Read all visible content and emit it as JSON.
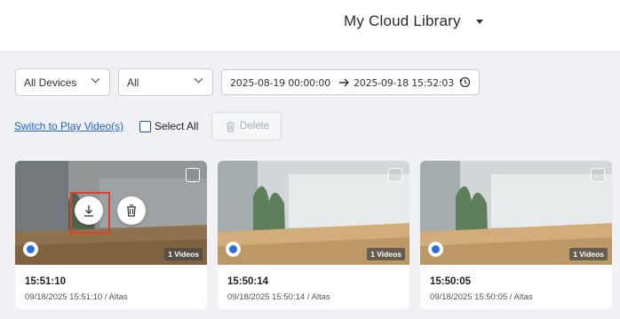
{
  "header": {
    "title": "My Cloud Library"
  },
  "filters": {
    "device": "All Devices",
    "type": "All",
    "start": "2025-08-19  00:00:00",
    "end": "2025-09-18  15:52:03"
  },
  "toolbar": {
    "switch_label": "Switch to Play Video(s)",
    "select_all_label": "Select All",
    "delete_label": "Delete"
  },
  "cards": [
    {
      "time": "15:51:10",
      "meta": "09/18/2025 15:51:10 / Altas",
      "badge": "1 Videos"
    },
    {
      "time": "15:50:14",
      "meta": "09/18/2025 15:50:14 / Altas",
      "badge": "1 Videos"
    },
    {
      "time": "15:50:05",
      "meta": "09/18/2025 15:50:05 / Altas",
      "badge": "1 Videos"
    }
  ],
  "colors": {
    "accent": "#1f62d8",
    "highlight": "#e0412f"
  }
}
